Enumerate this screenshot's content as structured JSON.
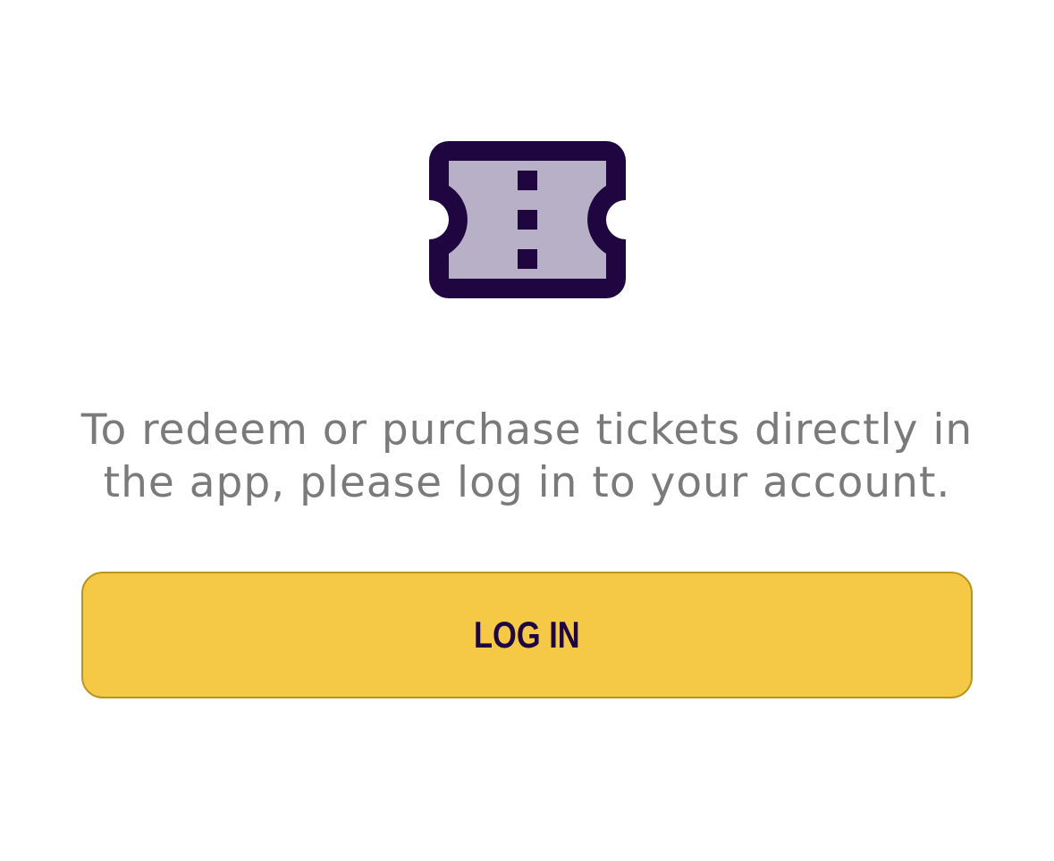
{
  "icon": {
    "name": "ticket-icon",
    "primary_color": "#1f0640",
    "fill_color": "#b7b0c6"
  },
  "message": {
    "text": "To redeem or purchase tickets directly in the app, please log in to your account."
  },
  "login_button": {
    "label": "LOG IN",
    "background": "#f5c945",
    "text_color": "#1f0640"
  }
}
